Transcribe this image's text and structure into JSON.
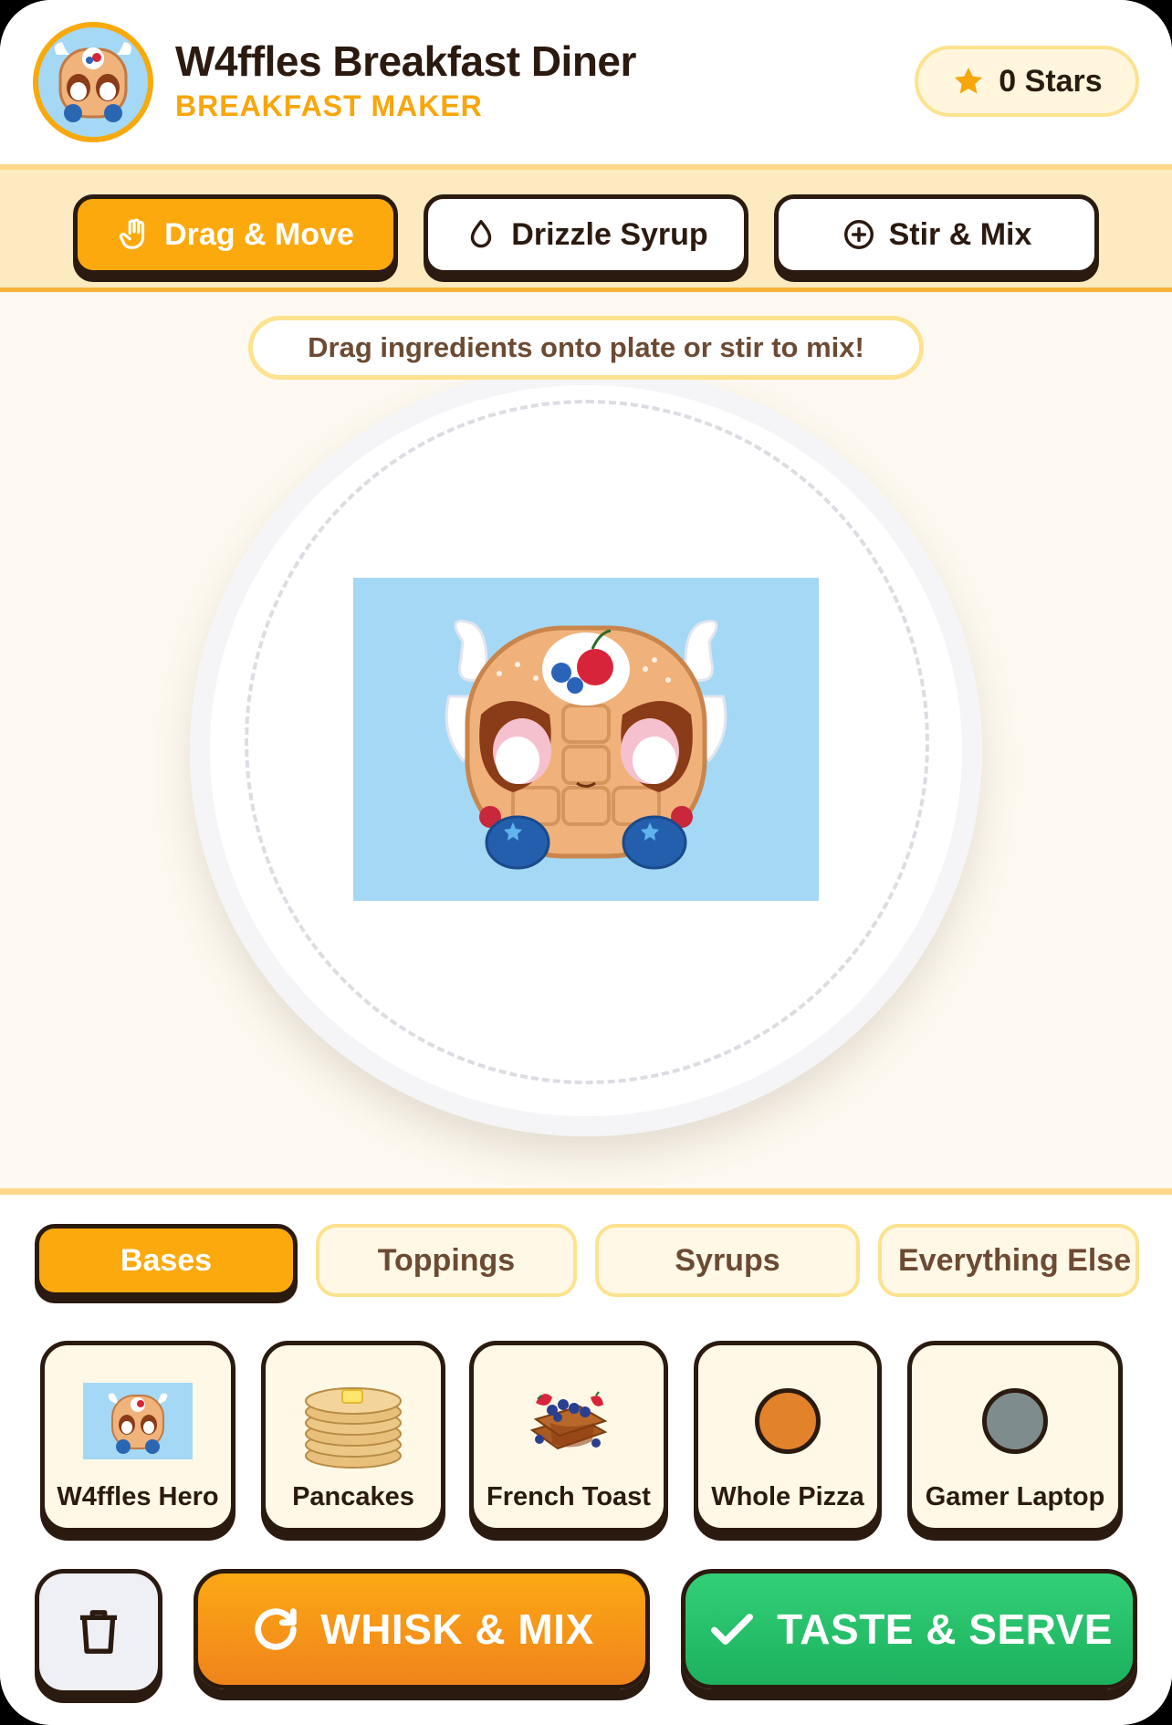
{
  "app": {
    "title": "W4ffles Breakfast Diner",
    "subtitle": "BREAKFAST MAKER",
    "stars_label": "0 Stars"
  },
  "tools": [
    {
      "label": "Drag & Move",
      "icon": "hand-pointer-icon",
      "active": true
    },
    {
      "label": "Drizzle Syrup",
      "icon": "droplet-icon",
      "active": false
    },
    {
      "label": "Stir & Mix",
      "icon": "plus-circle-icon",
      "active": false
    }
  ],
  "hint": "Drag ingredients onto plate or stir to mix!",
  "plate": {
    "item": "W4ffles Hero"
  },
  "categories": [
    {
      "label": "Bases",
      "active": true
    },
    {
      "label": "Toppings",
      "active": false
    },
    {
      "label": "Syrups",
      "active": false
    },
    {
      "label": "Everything Else",
      "active": false
    }
  ],
  "ingredients": [
    {
      "label": "W4ffles Hero",
      "visual": "waffle-character-image"
    },
    {
      "label": "Pancakes",
      "visual": "pancake-stack-image"
    },
    {
      "label": "French Toast",
      "visual": "french-toast-image"
    },
    {
      "label": "Whole Pizza",
      "visual": "color-dot",
      "color": "#e2822b"
    },
    {
      "label": "Gamer Laptop",
      "visual": "color-dot",
      "color": "#7f8c8d"
    }
  ],
  "actions": {
    "trash": "trash-icon",
    "whisk_label": "WHISK & MIX",
    "serve_label": "TASTE & SERVE"
  },
  "colors": {
    "accent": "#fba90c",
    "outline": "#2b1a10",
    "serve": "#22c066",
    "whisk": "#f39a18"
  }
}
